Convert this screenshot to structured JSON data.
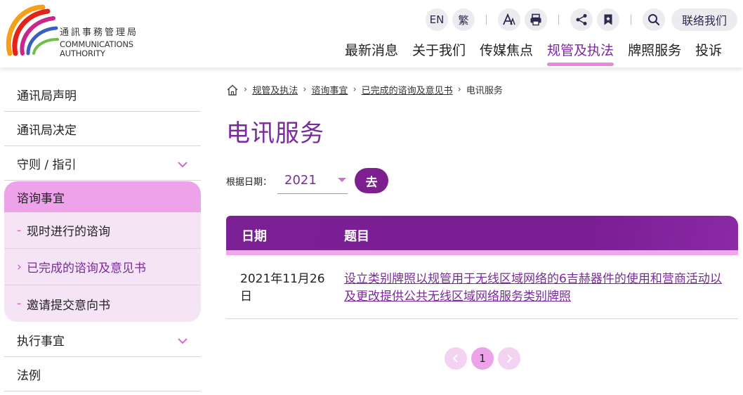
{
  "header": {
    "logo_zh": "通訊事務管理局",
    "logo_en_line1": "COMMUNICATIONS",
    "logo_en_line2": "AUTHORITY",
    "tools": {
      "lang_en": "EN",
      "lang_tc": "繁",
      "font_size_icon": "A",
      "contact_label": "联络我们"
    },
    "nav": [
      {
        "label": "最新消息"
      },
      {
        "label": "关于我们"
      },
      {
        "label": "传媒焦点"
      },
      {
        "label": "规管及执法",
        "active": true
      },
      {
        "label": "牌照服务"
      },
      {
        "label": "投诉"
      }
    ]
  },
  "sidebar": {
    "items": [
      {
        "label": "通讯局声明"
      },
      {
        "label": "通讯局决定"
      },
      {
        "label": "守则 / 指引",
        "expandable": true
      }
    ],
    "group": {
      "label": "谘询事宜",
      "children": [
        {
          "label": "现时进行的谘询",
          "marker": "-"
        },
        {
          "label": "已完成的谘询及意见书",
          "marker": "›",
          "active": true
        },
        {
          "label": "邀请提交意向书",
          "marker": "-"
        }
      ]
    },
    "items_after": [
      {
        "label": "执行事宜",
        "expandable": true
      },
      {
        "label": "法例"
      }
    ]
  },
  "breadcrumb": {
    "items": [
      "规管及执法",
      "谘询事宜",
      "已完成的谘询及意见书"
    ],
    "current": "电讯服务"
  },
  "page": {
    "title": "电讯服务",
    "filter_label": "根据日期：",
    "year_value": "2021",
    "go_label": "去"
  },
  "table": {
    "headers": {
      "date": "日期",
      "title": "题目"
    },
    "rows": [
      {
        "date": "2021年11月26日",
        "title": "设立类别牌照以规管用于无线区域网络的6吉赫器件的使用和营商活动以及更改提供公共无线区域网络服务类别牌照"
      }
    ]
  },
  "pagination": {
    "current": "1"
  },
  "colors": {
    "accent": "#7a2a9c",
    "pink": "#eea2e9",
    "pink_light": "#f5e4f6",
    "header_purple": "#7b1f95"
  }
}
